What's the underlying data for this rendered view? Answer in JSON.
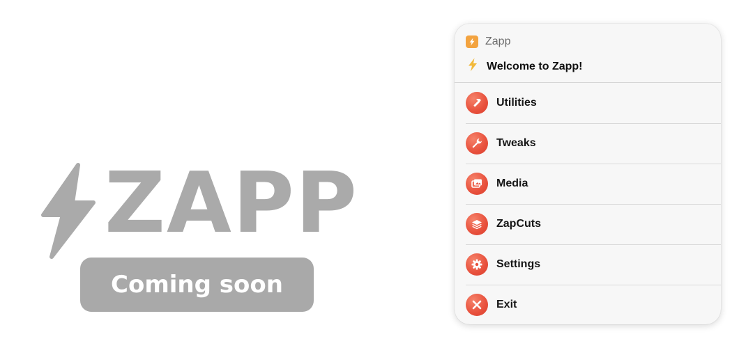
{
  "branding": {
    "wordmark": "ZAPP",
    "coming_soon": "Coming soon",
    "color": "#aaaaaa"
  },
  "menu_card": {
    "app_name": "Zapp",
    "app_icon": "lightning-bolt-icon",
    "welcome": "Welcome to Zapp!",
    "welcome_icon": "lightning-bolt-icon",
    "accent_color": "#e8503c",
    "items": [
      {
        "label": "Utilities",
        "icon": "hammer-icon"
      },
      {
        "label": "Tweaks",
        "icon": "wrench-icon"
      },
      {
        "label": "Media",
        "icon": "photos-icon"
      },
      {
        "label": "ZapCuts",
        "icon": "layers-icon"
      },
      {
        "label": "Settings",
        "icon": "gear-icon"
      },
      {
        "label": "Exit",
        "icon": "close-icon"
      }
    ]
  }
}
